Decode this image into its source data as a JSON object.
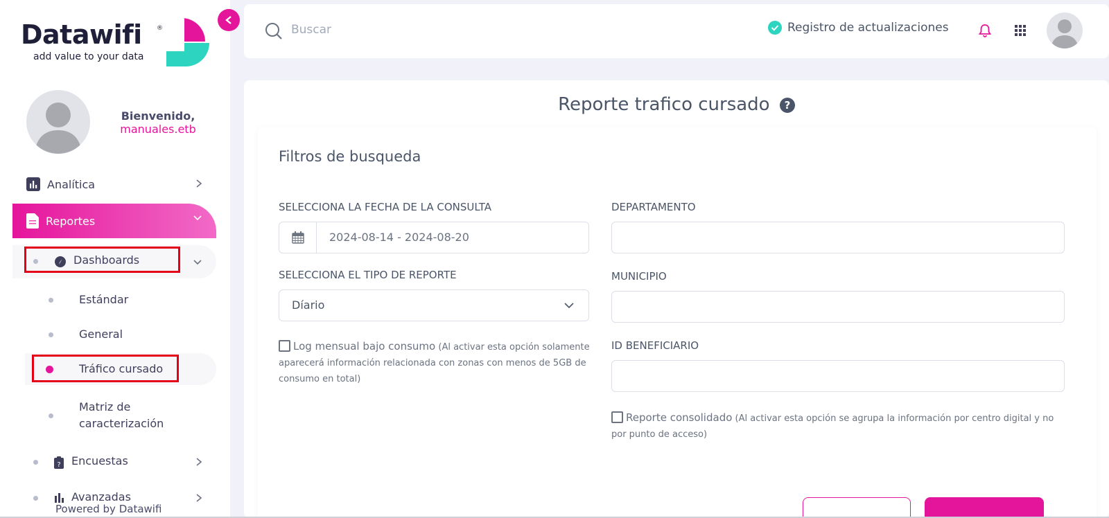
{
  "brand": {
    "name": "Datawifi",
    "registered": "®",
    "tagline": "add value to your data",
    "accent": "#e5159b",
    "secondary": "#2dd4bf"
  },
  "user": {
    "welcome": "Bienvenido,",
    "username": "manuales.etb"
  },
  "sidebar": {
    "items": [
      {
        "label": "Analítica",
        "icon": "bar-chart-icon"
      },
      {
        "label": "Reportes",
        "icon": "document-icon"
      },
      {
        "label": "Dashboards",
        "icon": "compass-icon"
      },
      {
        "label": "Estándar"
      },
      {
        "label": "General"
      },
      {
        "label": "Tráfico cursado"
      },
      {
        "label": "Matriz de caracterización"
      },
      {
        "label": "Encuestas",
        "icon": "clipboard-question-icon"
      },
      {
        "label": "Avanzadas",
        "icon": "bar-chart-icon"
      }
    ],
    "powered_by": "Powered by Datawifi"
  },
  "header": {
    "search_placeholder": "Buscar",
    "updates_label": "Registro de actualizaciones"
  },
  "main": {
    "title": "Reporte trafico cursado",
    "filters_title": "Filtros de busqueda",
    "date_label": "SELECCIONA LA FECHA DE LA CONSULTA",
    "date_value": "2024-08-14 - 2024-08-20",
    "report_type_label": "SELECCIONA EL TIPO DE REPORTE",
    "report_type_value": "Díario",
    "log_label": "Log mensual bajo consumo",
    "log_note": "(Al activar esta opción solamente aparecerá información relacionada con zonas con menos de 5GB de consumo en total)",
    "departamento_label": "DEPARTAMENTO",
    "municipio_label": "MUNICIPIO",
    "beneficiario_label": "ID BENEFICIARIO",
    "consolidado_label": "Reporte consolidado",
    "consolidado_note": "(Al activar esta opción se agrupa la información por centro digital y no por punto de acceso)"
  }
}
